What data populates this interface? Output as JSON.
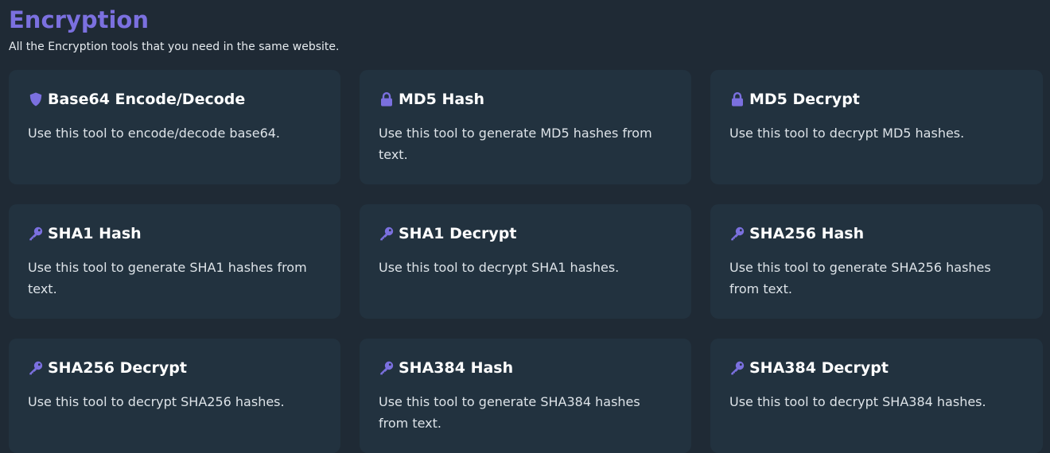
{
  "header": {
    "title": "Encryption",
    "subtitle": "All the Encryption tools that you need in the same website."
  },
  "colors": {
    "accent": "#7b70df",
    "background": "#1f2a35",
    "card": "#22323f"
  },
  "tools": [
    {
      "icon": "shield-icon",
      "title": "Base64 Encode/Decode",
      "description": "Use this tool to encode/decode base64."
    },
    {
      "icon": "lock-icon",
      "title": "MD5 Hash",
      "description": "Use this tool to generate MD5 hashes from text."
    },
    {
      "icon": "lock-icon",
      "title": "MD5 Decrypt",
      "description": "Use this tool to decrypt MD5 hashes."
    },
    {
      "icon": "key-icon",
      "title": "SHA1 Hash",
      "description": "Use this tool to generate SHA1 hashes from text."
    },
    {
      "icon": "key-icon",
      "title": "SHA1 Decrypt",
      "description": "Use this tool to decrypt SHA1 hashes."
    },
    {
      "icon": "key-icon",
      "title": "SHA256 Hash",
      "description": "Use this tool to generate SHA256 hashes from text."
    },
    {
      "icon": "key-icon",
      "title": "SHA256 Decrypt",
      "description": "Use this tool to decrypt SHA256 hashes."
    },
    {
      "icon": "key-icon",
      "title": "SHA384 Hash",
      "description": "Use this tool to generate SHA384 hashes from text."
    },
    {
      "icon": "key-icon",
      "title": "SHA384 Decrypt",
      "description": "Use this tool to decrypt SHA384 hashes."
    }
  ]
}
